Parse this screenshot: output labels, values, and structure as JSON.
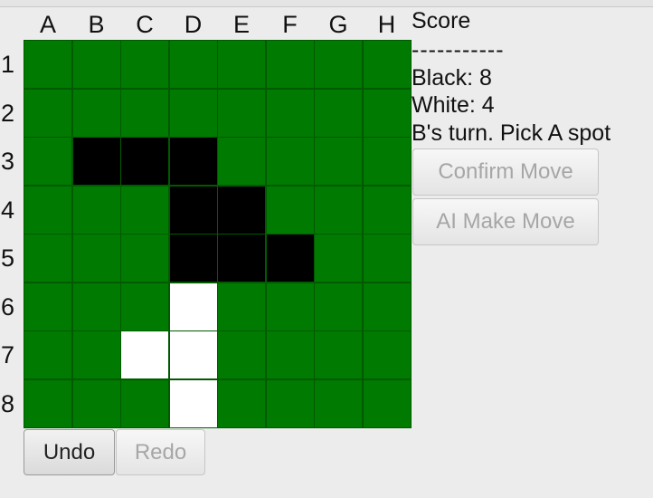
{
  "columns": [
    "A",
    "B",
    "C",
    "D",
    "E",
    "F",
    "G",
    "H"
  ],
  "rows": [
    "1",
    "2",
    "3",
    "4",
    "5",
    "6",
    "7",
    "8"
  ],
  "board": [
    [
      ".",
      ".",
      ".",
      ".",
      ".",
      ".",
      ".",
      "."
    ],
    [
      ".",
      ".",
      ".",
      ".",
      ".",
      ".",
      ".",
      "."
    ],
    [
      ".",
      "B",
      "B",
      "B",
      ".",
      ".",
      ".",
      "."
    ],
    [
      ".",
      ".",
      ".",
      "B",
      "B",
      ".",
      ".",
      "."
    ],
    [
      ".",
      ".",
      ".",
      "B",
      "B",
      "B",
      ".",
      "."
    ],
    [
      ".",
      ".",
      ".",
      "W",
      ".",
      ".",
      ".",
      "."
    ],
    [
      ".",
      ".",
      "W",
      "W",
      ".",
      ".",
      ".",
      "."
    ],
    [
      ".",
      ".",
      ".",
      "W",
      ".",
      ".",
      ".",
      "."
    ]
  ],
  "colors": {
    "board": "#007a00",
    "grid": "#005a00",
    "black_piece": "#000000",
    "white_piece": "#ffffff"
  },
  "score": {
    "heading": "Score",
    "divider": "-----------",
    "black": "Black: 8",
    "white": "White: 4",
    "status": "B's turn. Pick A spot"
  },
  "buttons": {
    "confirm": "Confirm Move",
    "ai_move": "AI Make Move",
    "undo": "Undo",
    "redo": "Redo"
  }
}
